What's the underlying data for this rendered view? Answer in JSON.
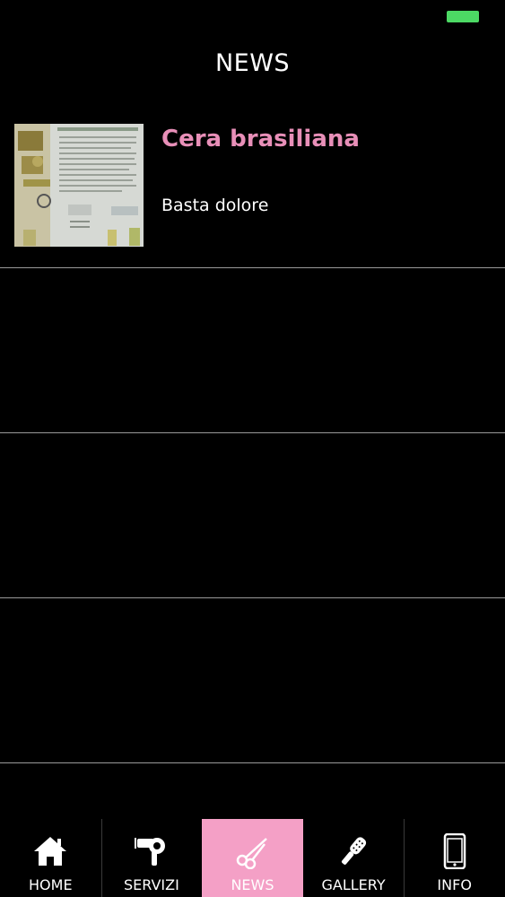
{
  "page": {
    "title": "NEWS"
  },
  "news": [
    {
      "title": "Cera brasiliana",
      "subtitle": "Basta dolore"
    }
  ],
  "tabs": [
    {
      "label": "HOME",
      "icon": "home-icon"
    },
    {
      "label": "SERVIZI",
      "icon": "hair-dryer-icon"
    },
    {
      "label": "NEWS",
      "icon": "scissors-icon",
      "active": true
    },
    {
      "label": "GALLERY",
      "icon": "hair-brush-icon"
    },
    {
      "label": "INFO",
      "icon": "phone-icon"
    }
  ],
  "colors": {
    "accent": "#f4a0c6",
    "news_title": "#e88fb8",
    "battery": "#4cd964"
  }
}
